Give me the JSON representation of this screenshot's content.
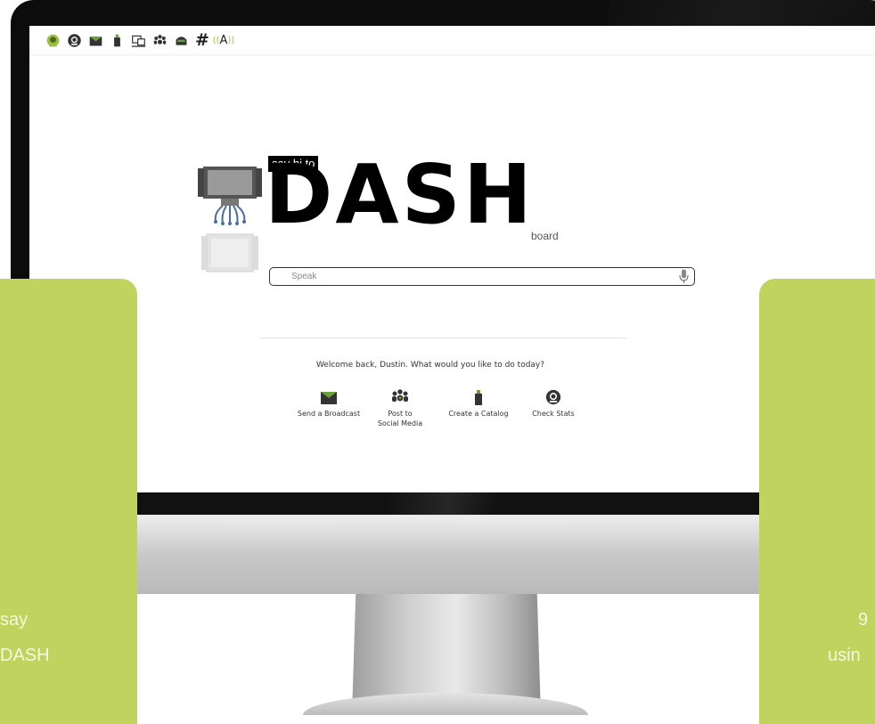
{
  "app": {
    "say_hi": "say hi to",
    "logo": "DASH",
    "logo_suffix": "board"
  },
  "toolbar": {
    "icons": [
      "dashboard-icon",
      "stats-icon",
      "broadcast-icon",
      "catalog-icon",
      "monitor-icon",
      "social-icon",
      "inbox-icon",
      "hashtag-icon",
      "voice-icon"
    ],
    "hash_label": "#",
    "voice_label": "A",
    "voice_waves_left": "((",
    "voice_waves_right": "))"
  },
  "search": {
    "placeholder": "Speak",
    "value": ""
  },
  "welcome": "Welcome back, Dustin. What would you like to do today?",
  "actions": [
    {
      "label": "Send a Broadcast",
      "icon": "envelope-icon"
    },
    {
      "label": "Post to",
      "label2": "Social Media",
      "icon": "people-icon"
    },
    {
      "label": "Create a Catalog",
      "icon": "spray-can-icon"
    },
    {
      "label": "Check Stats",
      "icon": "stats-icon"
    }
  ],
  "side_panels": {
    "left": [
      "say",
      "DASH"
    ],
    "right": [
      "9",
      "usin"
    ]
  },
  "colors": {
    "accent_green": "#bfd35e",
    "icon_green": "#5f8a3a",
    "bezel": "#0c0c0c"
  }
}
